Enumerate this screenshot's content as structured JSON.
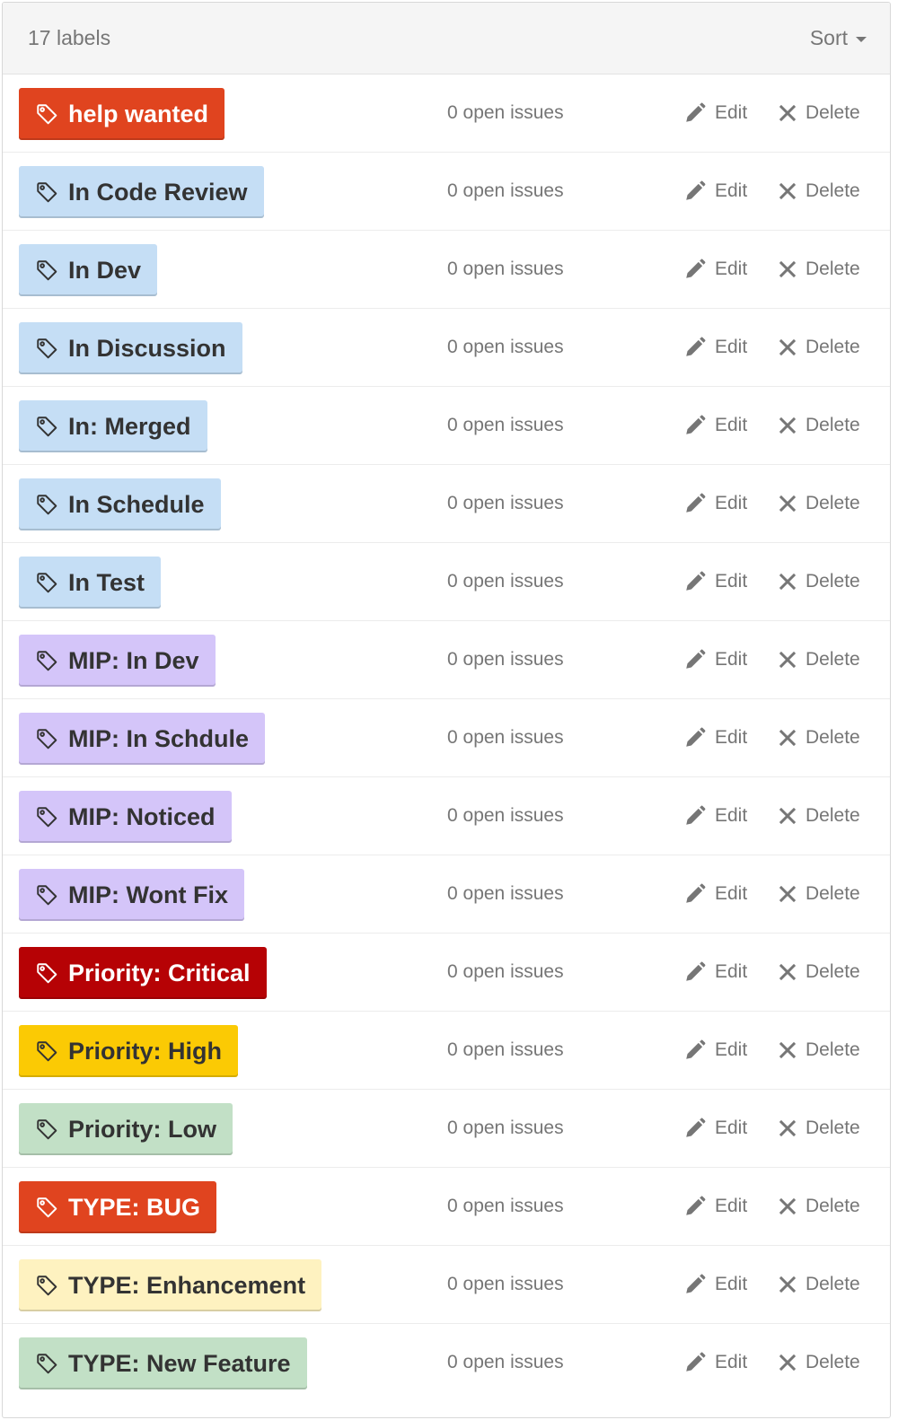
{
  "header": {
    "label_count": "17 labels",
    "sort_label": "Sort"
  },
  "actions": {
    "edit_label": "Edit",
    "delete_label": "Delete"
  },
  "labels": [
    {
      "name": "help wanted",
      "issues": "0 open issues",
      "bg": "#e0441f",
      "fg": "#ffffff"
    },
    {
      "name": "In Code Review",
      "issues": "0 open issues",
      "bg": "#c5def5",
      "fg": "#333333"
    },
    {
      "name": "In Dev",
      "issues": "0 open issues",
      "bg": "#c5def5",
      "fg": "#333333"
    },
    {
      "name": "In Discussion",
      "issues": "0 open issues",
      "bg": "#c5def5",
      "fg": "#333333"
    },
    {
      "name": "In: Merged",
      "issues": "0 open issues",
      "bg": "#c5def5",
      "fg": "#333333"
    },
    {
      "name": "In Schedule",
      "issues": "0 open issues",
      "bg": "#c5def5",
      "fg": "#333333"
    },
    {
      "name": "In Test",
      "issues": "0 open issues",
      "bg": "#c5def5",
      "fg": "#333333"
    },
    {
      "name": "MIP: In Dev",
      "issues": "0 open issues",
      "bg": "#d4c5f9",
      "fg": "#333333"
    },
    {
      "name": "MIP: In Schdule",
      "issues": "0 open issues",
      "bg": "#d4c5f9",
      "fg": "#333333"
    },
    {
      "name": "MIP: Noticed",
      "issues": "0 open issues",
      "bg": "#d4c5f9",
      "fg": "#333333"
    },
    {
      "name": "MIP: Wont Fix",
      "issues": "0 open issues",
      "bg": "#d4c5f9",
      "fg": "#333333"
    },
    {
      "name": "Priority: Critical",
      "issues": "0 open issues",
      "bg": "#b60205",
      "fg": "#ffffff"
    },
    {
      "name": "Priority: High",
      "issues": "0 open issues",
      "bg": "#fbca04",
      "fg": "#333333"
    },
    {
      "name": "Priority: Low",
      "issues": "0 open issues",
      "bg": "#c2e0c6",
      "fg": "#333333"
    },
    {
      "name": "TYPE: BUG",
      "issues": "0 open issues",
      "bg": "#e0441f",
      "fg": "#ffffff"
    },
    {
      "name": "TYPE: Enhancement",
      "issues": "0 open issues",
      "bg": "#fef2c0",
      "fg": "#333333"
    },
    {
      "name": "TYPE: New Feature",
      "issues": "0 open issues",
      "bg": "#c2e0c6",
      "fg": "#333333"
    }
  ]
}
